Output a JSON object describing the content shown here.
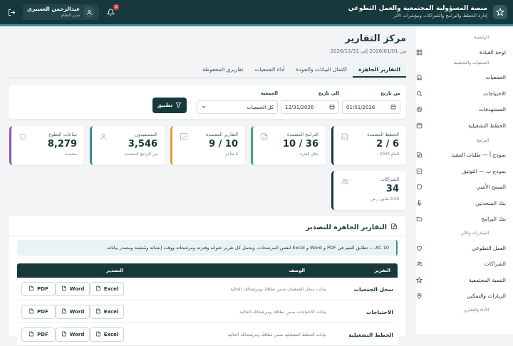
{
  "app": {
    "title": "منصة المسؤولية المجتمعية والعمل التطوعي",
    "subtitle": "إدارة الخطط والبرامج والشراكات ومؤشرات الأثر"
  },
  "user": {
    "name": "عبدالرحمن العسيري",
    "role": "مدير النظام",
    "notifications": "2"
  },
  "sidebar": {
    "sections": [
      {
        "title": "الرئيسية",
        "items": [
          {
            "label": "لوحة القيادة",
            "icon": "grid-icon"
          }
        ]
      },
      {
        "title": "الجمعيات والتخطيط",
        "items": [
          {
            "label": "الجمعيات",
            "icon": "building-icon"
          },
          {
            "label": "الاحتياجات",
            "icon": "search-icon"
          },
          {
            "label": "المستهدفات",
            "icon": "target-icon"
          },
          {
            "label": "الخطط التشغيلية",
            "icon": "calendar-icon"
          }
        ]
      },
      {
        "title": "البرامج",
        "items": [
          {
            "label": "نموذج أ — طلبات التنفيذ",
            "icon": "file-edit-icon"
          },
          {
            "label": "نموذج ب — التوثيق",
            "icon": "check-square-icon"
          },
          {
            "label": "المسح الأمني",
            "icon": "shield-icon"
          },
          {
            "label": "بنك المتحدثين",
            "icon": "mic-icon"
          },
          {
            "label": "بنك البرامج",
            "icon": "folder-icon"
          }
        ]
      },
      {
        "title": "المبادرات والأثر",
        "items": [
          {
            "label": "العمل التطوعي",
            "icon": "heart-icon"
          },
          {
            "label": "الشراكات",
            "icon": "users-icon"
          },
          {
            "label": "التنمية المجتمعية",
            "icon": "star-icon"
          },
          {
            "label": "الزيارات والتمكين",
            "icon": "map-pin-icon"
          }
        ]
      },
      {
        "title": "الأداء والتقارير",
        "items": []
      }
    ]
  },
  "page": {
    "title": "مركز التقارير",
    "date_range": "من 2026/01/01 إلى 2026/12/31"
  },
  "tabs": [
    "التقارير الجاهزة",
    "اكتمال البيانات والجودة",
    "أداء الجمعيات",
    "تقاريري المحفوظة"
  ],
  "filters": {
    "from_label": "من تاريخ",
    "from_value": "01/01/2026",
    "to_label": "إلى تاريخ",
    "to_value": "12/31/2026",
    "assoc_label": "الجمعية",
    "assoc_value": "كل الجمعيات",
    "apply_label": "تطبيق"
  },
  "kpis": [
    {
      "title": "الخطط المعتمدة",
      "value": "2 / 6",
      "sub": "للعام 2026",
      "icon": "book-icon",
      "color": "#17393b"
    },
    {
      "title": "البرامج المعتمدة",
      "value": "10 / 36",
      "sub": "خلال الفترة",
      "icon": "file-icon",
      "color": "#4aa86a"
    },
    {
      "title": "التقارير المعتمدة",
      "value": "9 / 10",
      "sub": "4 متأخر",
      "icon": "check-square-icon",
      "color": "#e0a03a"
    },
    {
      "title": "المستفيدون",
      "value": "3,546",
      "sub": "من البرامج المعتمدة",
      "icon": "user-icon",
      "color": "#3c8f96"
    },
    {
      "title": "ساعات التطوع",
      "value": "8,279",
      "sub": "معتمدة",
      "icon": "heart-icon",
      "color": "#8a5aa6"
    },
    {
      "title": "الشراكات",
      "value": "34",
      "sub": "9.20 مليون ر.س",
      "icon": "users-icon",
      "color": "#17393b"
    }
  ],
  "export": {
    "title": "التقارير الجاهزة للتصدير",
    "note": "AC 10 — تطابق القيم في PDF و Word و Excel لنفس المرشحات، ويحمل كل تقرير عنوانه وفترته ومرشحاته ووقت إنشائه ومُنشئه ومصدر بياناته.",
    "columns": {
      "report": "التقرير",
      "description": "الوصف",
      "export": "التصدير"
    },
    "rows": [
      {
        "name": "سجل الجمعيات",
        "description": "بيانات سجل الجمعيات ضمن نطاقك ومرشحاتك الحالية"
      },
      {
        "name": "الاحتياجات",
        "description": "بيانات الاحتياجات ضمن نطاقك ومرشحاتك الحالية"
      },
      {
        "name": "الخطط التشغيلية",
        "description": "بيانات الخطط التشغيلية ضمن نطاقك ومرشحاتك الحالية"
      }
    ],
    "buttons": {
      "excel": "Excel",
      "word": "Word",
      "pdf": "PDF"
    }
  }
}
